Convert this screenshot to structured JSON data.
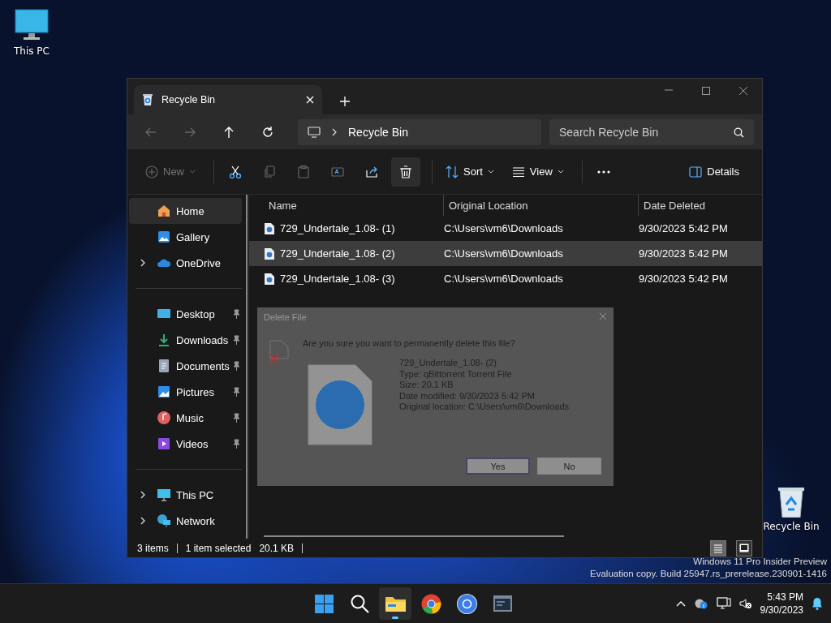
{
  "desktop_icons": [
    {
      "label": "This PC",
      "kind": "pc"
    },
    {
      "label": "Recycle Bin",
      "kind": "bin"
    }
  ],
  "watermark": {
    "line1": "Windows 11 Pro Insider Preview",
    "line2": "Evaluation copy. Build 25947.rs_prerelease.230901-1416"
  },
  "window": {
    "tab": {
      "title": "Recycle Bin",
      "selected": true
    },
    "address": {
      "path": "Recycle Bin"
    },
    "search": {
      "placeholder": "Search Recycle Bin"
    },
    "nav_buttons": [
      {
        "kind": "back",
        "disabled": true
      },
      {
        "kind": "forward",
        "disabled": true
      },
      {
        "kind": "up",
        "disabled": false
      },
      {
        "kind": "refresh",
        "disabled": false
      }
    ],
    "toolbar": [
      {
        "kind": "new",
        "label": "New",
        "disabled": true
      },
      {
        "kind": "cut",
        "disabled": false
      },
      {
        "kind": "copy",
        "disabled": true
      },
      {
        "kind": "paste",
        "disabled": true
      },
      {
        "kind": "rename",
        "disabled": true
      },
      {
        "kind": "share",
        "disabled": false
      },
      {
        "kind": "delete",
        "disabled": false,
        "selected": true
      },
      {
        "kind": "sort",
        "label": "Sort",
        "disabled": false
      },
      {
        "kind": "view",
        "label": "View",
        "disabled": false
      },
      {
        "kind": "more",
        "disabled": false
      },
      {
        "kind": "details",
        "label": "Details",
        "disabled": false
      }
    ],
    "sidebar": {
      "groups": [
        {
          "items": [
            {
              "label": "Home",
              "kind": "home",
              "selected": true,
              "expandable": false,
              "pinned": false
            },
            {
              "label": "Gallery",
              "kind": "gallery",
              "selected": false,
              "expandable": false,
              "pinned": false
            },
            {
              "label": "OneDrive",
              "kind": "cloud",
              "selected": false,
              "expandable": true,
              "pinned": false
            }
          ]
        },
        {
          "items": [
            {
              "label": "Desktop",
              "kind": "desktop",
              "selected": false,
              "expandable": false,
              "pinned": true
            },
            {
              "label": "Downloads",
              "kind": "downloads",
              "selected": false,
              "expandable": false,
              "pinned": true
            },
            {
              "label": "Documents",
              "kind": "documents",
              "selected": false,
              "expandable": false,
              "pinned": true
            },
            {
              "label": "Pictures",
              "kind": "pictures",
              "selected": false,
              "expandable": false,
              "pinned": true
            },
            {
              "label": "Music",
              "kind": "music",
              "selected": false,
              "expandable": false,
              "pinned": true
            },
            {
              "label": "Videos",
              "kind": "videos",
              "selected": false,
              "expandable": false,
              "pinned": true
            }
          ]
        },
        {
          "items": [
            {
              "label": "This PC",
              "kind": "pc",
              "selected": false,
              "expandable": true,
              "pinned": false
            },
            {
              "label": "Network",
              "kind": "network",
              "selected": false,
              "expandable": true,
              "pinned": false
            }
          ]
        }
      ]
    },
    "table": {
      "columns": [
        "Name",
        "Original Location",
        "Date Deleted"
      ],
      "rows": [
        {
          "name": "729_Undertale_1.08- (1)",
          "location": "C:\\Users\\vm6\\Downloads",
          "date": "9/30/2023 5:42 PM",
          "selected": false
        },
        {
          "name": "729_Undertale_1.08- (2)",
          "location": "C:\\Users\\vm6\\Downloads",
          "date": "9/30/2023 5:42 PM",
          "selected": true
        },
        {
          "name": "729_Undertale_1.08- (3)",
          "location": "C:\\Users\\vm6\\Downloads",
          "date": "9/30/2023 5:42 PM",
          "selected": false
        }
      ]
    },
    "status_bar": {
      "count": "3 items",
      "selection": "1 item selected",
      "size": "20.1 KB",
      "views": [
        {
          "kind": "details",
          "selected": true
        },
        {
          "kind": "tiles",
          "selected": false
        }
      ]
    }
  },
  "dialog": {
    "title": "Delete File",
    "question": "Are you sure you want to permanently delete this file?",
    "file_name": "729_Undertale_1.08- (2)",
    "type": "Type: qBittorrent Torrent File",
    "size": "Size: 20.1 KB",
    "modified": "Date modified: 9/30/2023 5:42 PM",
    "location": "Original location: C:\\Users\\vm6\\Downloads",
    "buttons": [
      {
        "label": "Yes",
        "selected": true
      },
      {
        "label": "No",
        "selected": false
      }
    ]
  },
  "taskbar": {
    "apps": [
      {
        "kind": "start",
        "selected": false
      },
      {
        "kind": "search",
        "selected": false
      },
      {
        "kind": "explorer",
        "selected": true
      },
      {
        "kind": "browser",
        "selected": false
      },
      {
        "kind": "torrent",
        "selected": false
      },
      {
        "kind": "terminal",
        "selected": false
      }
    ],
    "time": "5:43 PM",
    "date": "9/30/2023"
  }
}
